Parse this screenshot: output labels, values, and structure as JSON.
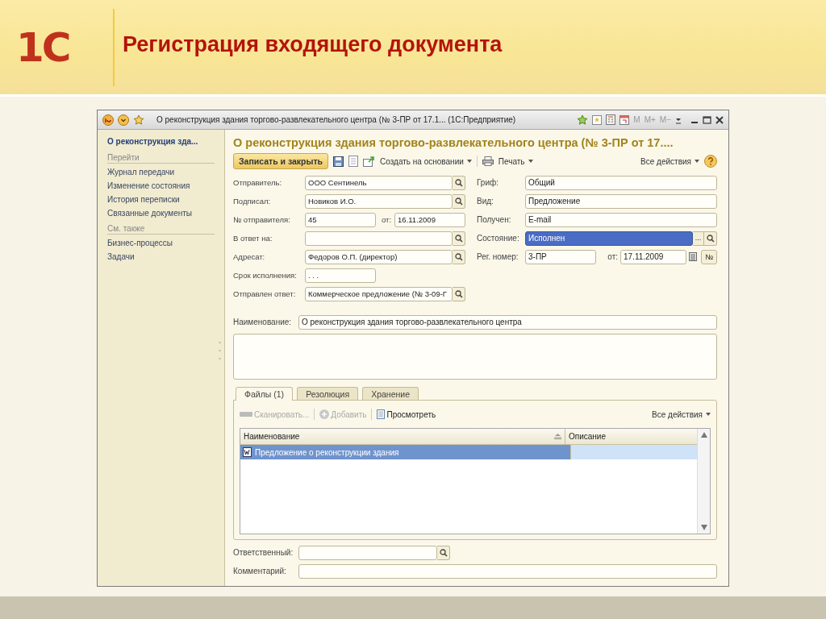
{
  "slide": {
    "logo": "1С",
    "title": "Регистрация входящего документа"
  },
  "window": {
    "title": "О реконструкция здания торгово-развлекательного центра (№ 3-ПР от 17.1... (1С:Предприятие)",
    "memory_keys": [
      "M",
      "M+",
      "M−"
    ]
  },
  "sidebar": {
    "title": "О реконструкция зда...",
    "sections": [
      {
        "heading": "Перейти",
        "items": [
          "Журнал передачи",
          "Изменение состояния",
          "История переписки",
          "Связанные документы"
        ]
      },
      {
        "heading": "См. также",
        "items": [
          "Бизнес-процессы",
          "Задачи"
        ]
      }
    ]
  },
  "form": {
    "heading": "О реконструкция здания торгово-развлекательного центра (№ 3-ПР от 17....",
    "actions": {
      "primary": "Записать и закрыть",
      "create_based": "Создать на основании",
      "print": "Печать",
      "all_actions": "Все действия"
    },
    "left_fields": [
      {
        "kind": "lookup",
        "label": "Отправитель:",
        "value": "ООО Сентинель"
      },
      {
        "kind": "lookup",
        "label": "Подписал:",
        "value": "Новиков И.О."
      },
      {
        "kind": "pair",
        "label": "№ отправителя:",
        "value": "45",
        "date_label": "от:",
        "date": "16.11.2009"
      },
      {
        "kind": "lookup",
        "label": "В ответ на:"
      },
      {
        "kind": "lookup",
        "label": "Адресат:",
        "value": "Федоров О.П. (директор)"
      },
      {
        "kind": "short",
        "label": "Срок исполнения:",
        "value": ". . ."
      },
      {
        "kind": "lookup",
        "label": "Отправлен ответ:",
        "value": "Коммерческое предложение (№ 3-09-Г"
      }
    ],
    "right_fields": [
      {
        "kind": "text",
        "label": "Гриф:",
        "value": "Общий"
      },
      {
        "kind": "text",
        "label": "Вид:",
        "value": "Предложение"
      },
      {
        "kind": "text",
        "label": "Получен:",
        "value": "E-mail"
      },
      {
        "kind": "choice",
        "label": "Состояние:",
        "value": "Исполнен",
        "focused": true,
        "choice_button": "..."
      },
      {
        "kind": "regnum",
        "label": "Рег. номер:",
        "value": "3-ПР",
        "date_label": "от:",
        "date": "17.11.2009",
        "number_button": "№"
      }
    ],
    "name_field": {
      "label": "Наименование:",
      "value": "О реконструкция здания торгово-развлекательного центра"
    },
    "tabs": [
      {
        "label": "Файлы (1)",
        "selected": true
      },
      {
        "label": "Резолюция",
        "selected": false
      },
      {
        "label": "Хранение",
        "selected": false
      }
    ],
    "files_toolbar": [
      {
        "kind": "scan",
        "label": "Сканировать...",
        "disabled": true
      },
      {
        "kind": "add",
        "label": "Добавить",
        "disabled": true
      },
      {
        "kind": "view",
        "label": "Просмотреть",
        "disabled": false
      }
    ],
    "files_all_actions": "Все действия",
    "table": {
      "columns": [
        "Наименование",
        "Описание"
      ],
      "rows": [
        {
          "name": "Предложение о реконструкции здания",
          "selected": true
        }
      ]
    },
    "bottom_fields": [
      {
        "kind": "lookup",
        "label": "Ответственный:"
      },
      {
        "kind": "text",
        "label": "Комментарий:"
      }
    ]
  }
}
